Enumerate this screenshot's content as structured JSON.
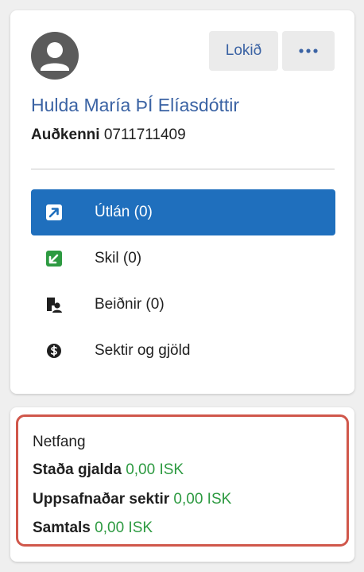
{
  "patron": {
    "name": "Hulda María ÞÍ Elíasdóttir",
    "id_label": "Auðkenni",
    "id_value": "0711711409"
  },
  "toolbar": {
    "done_label": "Lokið",
    "more_icon": "more-horizontal-icon"
  },
  "menu": [
    {
      "label": "Útlán (0)",
      "icon": "external-link-icon",
      "active": true,
      "icon_color": "#1f6fbd"
    },
    {
      "label": "Skil (0)",
      "icon": "check-in-icon",
      "active": false,
      "icon_color": "#2d9a41"
    },
    {
      "label": "Beiðnir (0)",
      "icon": "requests-icon",
      "active": false,
      "icon_color": "#1f1f1f"
    },
    {
      "label": "Sektir og gjöld",
      "icon": "dollar-circle-icon",
      "active": false,
      "icon_color": "#1f1f1f"
    }
  ],
  "info": {
    "email_label": "Netfang",
    "fees_status_label": "Staða gjalda",
    "fees_status_value": "0,00 ISK",
    "accrued_fines_label": "Uppsafnaðar sektir",
    "accrued_fines_value": "0,00 ISK",
    "total_label": "Samtals",
    "total_value": "0,00 ISK"
  },
  "colors": {
    "accent": "#1f6fbd",
    "link": "#3b63a4",
    "positive": "#2d9a41",
    "highlight_border": "#d0574b"
  }
}
